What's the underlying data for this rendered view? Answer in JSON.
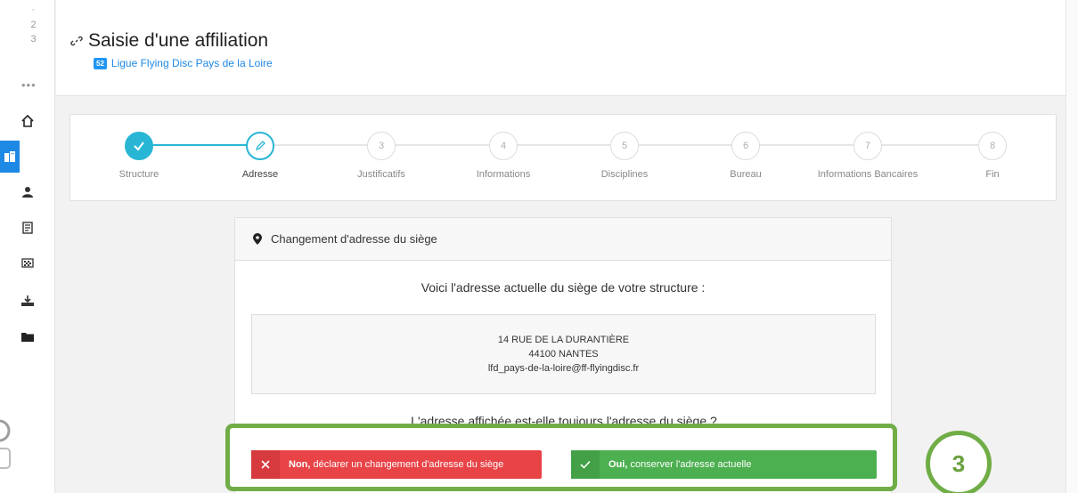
{
  "sidebar": {
    "numbers": [
      "2",
      "3"
    ],
    "more": "•••",
    "items": [
      {
        "name": "home-icon",
        "active": false
      },
      {
        "name": "building-icon",
        "active": true
      },
      {
        "name": "users-icon",
        "active": false
      },
      {
        "name": "newspaper-icon",
        "active": false
      },
      {
        "name": "flag-icon",
        "active": false
      },
      {
        "name": "download-icon",
        "active": false
      },
      {
        "name": "folder-icon",
        "active": false
      }
    ]
  },
  "header": {
    "title": "Saisie d'une affiliation",
    "badge": "52",
    "league": "Ligue Flying Disc Pays de la Loire"
  },
  "stepper": {
    "accent": "#29b6d4",
    "steps": [
      {
        "number": "",
        "label": "Structure",
        "state": "done"
      },
      {
        "number": "",
        "label": "Adresse",
        "state": "current"
      },
      {
        "number": "3",
        "label": "Justificatifs",
        "state": "todo"
      },
      {
        "number": "4",
        "label": "Informations",
        "state": "todo"
      },
      {
        "number": "5",
        "label": "Disciplines",
        "state": "todo"
      },
      {
        "number": "6",
        "label": "Bureau",
        "state": "todo"
      },
      {
        "number": "7",
        "label": "Informations Bancaires",
        "state": "todo"
      },
      {
        "number": "8",
        "label": "Fin",
        "state": "todo"
      }
    ]
  },
  "panel": {
    "heading": "Changement d'adresse du siège",
    "intro": "Voici l'adresse actuelle du siège de votre structure :",
    "address": {
      "street": "14 RUE DE LA DURANTIÈRE",
      "city": "44100 NANTES",
      "email": "lfd_pays-de-la-loire@ff-flyingdisc.fr"
    },
    "question": "L'adresse affichée est-elle toujours l'adresse du siège ?"
  },
  "buttons": {
    "no_bold": "Non,",
    "no_rest": " déclarer un changement d'adresse du siège",
    "yes_bold": "Oui,",
    "yes_rest": " conserver l'adresse actuelle"
  },
  "annotation": {
    "label": "3",
    "color": "#70ad47"
  }
}
